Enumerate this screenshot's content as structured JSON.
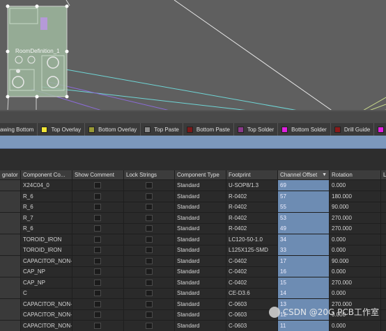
{
  "canvas": {
    "component_label": "RoomDefinition_1",
    "colors": {
      "background": "#5f5f5f",
      "component_fill": "#9fb89f",
      "connection_cyan": "#6fd6d6",
      "connection_purple": "#8c6cd8"
    }
  },
  "layers": [
    {
      "label": "awing Bottom",
      "color": "#6a6a6a"
    },
    {
      "label": "Top Overlay",
      "color": "#f2e635"
    },
    {
      "label": "Bottom Overlay",
      "color": "#9a9a35"
    },
    {
      "label": "Top Paste",
      "color": "#8a8a8a"
    },
    {
      "label": "Bottom Paste",
      "color": "#7a1a1a"
    },
    {
      "label": "Top Solder",
      "color": "#8a3a8a"
    },
    {
      "label": "Bottom Solder",
      "color": "#e020e0"
    },
    {
      "label": "Drill Guide",
      "color": "#8a1a1a"
    },
    {
      "label": "",
      "color": "#e020e0"
    }
  ],
  "grid": {
    "columns": [
      {
        "label": "gnator",
        "sorted": false
      },
      {
        "label": "Component Co...",
        "sorted": false
      },
      {
        "label": "Show Comment",
        "sorted": false
      },
      {
        "label": "Lock Strings",
        "sorted": false
      },
      {
        "label": "Component Type",
        "sorted": false
      },
      {
        "label": "Footprint",
        "sorted": false
      },
      {
        "label": "Channel Offset",
        "sorted": true
      },
      {
        "label": "Rotation",
        "sorted": false
      },
      {
        "label": "L",
        "sorted": false
      }
    ],
    "rows": [
      {
        "comment": "X24C04_0",
        "type": "Standard",
        "footprint": "U-SOP8/1.3",
        "channel_offset": "69",
        "rotation": "0.000"
      },
      {
        "comment": "R_6",
        "type": "Standard",
        "footprint": "R-0402",
        "channel_offset": "57",
        "rotation": "180.000"
      },
      {
        "comment": "R_6",
        "type": "Standard",
        "footprint": "R-0402",
        "channel_offset": "55",
        "rotation": "90.000"
      },
      {
        "comment": "R_7",
        "type": "Standard",
        "footprint": "R-0402",
        "channel_offset": "53",
        "rotation": "270.000"
      },
      {
        "comment": "R_6",
        "type": "Standard",
        "footprint": "R-0402",
        "channel_offset": "49",
        "rotation": "270.000"
      },
      {
        "comment": "TOROID_IRON",
        "type": "Standard",
        "footprint": "LC120-50-1.0",
        "channel_offset": "34",
        "rotation": "0.000"
      },
      {
        "comment": "TOROID_IRON",
        "type": "Standard",
        "footprint": "L125X125-SMD",
        "channel_offset": "33",
        "rotation": "0.000"
      },
      {
        "comment": "CAPACITOR_NON-F",
        "type": "Standard",
        "footprint": "C-0402",
        "channel_offset": "17",
        "rotation": "90.000"
      },
      {
        "comment": "CAP_NP",
        "type": "Standard",
        "footprint": "C-0402",
        "channel_offset": "16",
        "rotation": "0.000"
      },
      {
        "comment": "CAP_NP",
        "type": "Standard",
        "footprint": "C-0402",
        "channel_offset": "15",
        "rotation": "270.000"
      },
      {
        "comment": "C",
        "type": "Standard",
        "footprint": "CE-D3.6",
        "channel_offset": "14",
        "rotation": "0.000"
      },
      {
        "comment": "CAPACITOR_NON-F",
        "type": "Standard",
        "footprint": "C-0603",
        "channel_offset": "13",
        "rotation": "270.000"
      },
      {
        "comment": "CAPACITOR_NON-F",
        "type": "Standard",
        "footprint": "C-0603",
        "channel_offset": "12",
        "rotation": "0.000"
      },
      {
        "comment": "CAPACITOR_NON-F",
        "type": "Standard",
        "footprint": "C-0603",
        "channel_offset": "11",
        "rotation": "0.000"
      }
    ]
  },
  "watermark": {
    "text": "CSDN @20G PCB工作室"
  }
}
